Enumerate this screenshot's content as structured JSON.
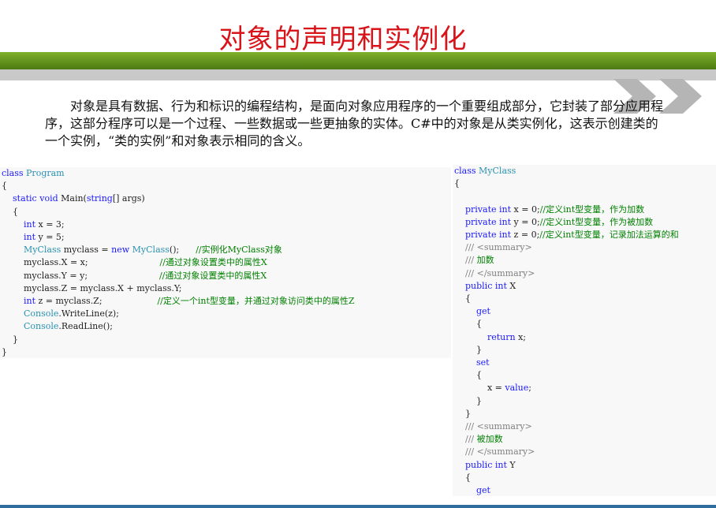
{
  "title": "对象的声明和实例化",
  "paragraph": "对象是具有数据、行为和标识的编程结构，是面向对象应用程序的一个重要组成部分，它封装了部分应用程序，这部分程序可以是一个过程、一些数据或一些更抽象的实体。C#中的对象是从类实例化，这表示创建类的一个实例，“类的实例”和对象表示相同的含义。",
  "colors": {
    "title": "#d8141a",
    "green_bar": "#6a9a1f",
    "gray_bar": "#c9c9c9",
    "keyword": "#1a1aff",
    "type": "#2b91af",
    "comment": "#008000"
  },
  "code_left": [
    [
      [
        "kw",
        "class"
      ],
      [
        "t",
        " "
      ],
      [
        "ty",
        "Program"
      ]
    ],
    [
      [
        "t",
        "{"
      ]
    ],
    [
      [
        "t",
        "    "
      ],
      [
        "kw",
        "static"
      ],
      [
        "t",
        " "
      ],
      [
        "kw",
        "void"
      ],
      [
        "t",
        " Main("
      ],
      [
        "kw",
        "string"
      ],
      [
        "t",
        "[] args)"
      ]
    ],
    [
      [
        "t",
        "    {"
      ]
    ],
    [
      [
        "t",
        "        "
      ],
      [
        "kw",
        "int"
      ],
      [
        "t",
        " x = 3;"
      ]
    ],
    [
      [
        "t",
        "        "
      ],
      [
        "kw",
        "int"
      ],
      [
        "t",
        " y = 5;"
      ]
    ],
    [
      [
        "t",
        "        "
      ],
      [
        "ty",
        "MyClass"
      ],
      [
        "t",
        " myclass = "
      ],
      [
        "kw",
        "new"
      ],
      [
        "t",
        " "
      ],
      [
        "ty",
        "MyClass"
      ],
      [
        "t",
        "();      "
      ],
      [
        "cm",
        "//实例化MyClass对象"
      ]
    ],
    [
      [
        "t",
        "        myclass.X = x;                          "
      ],
      [
        "cm",
        "//通过对象设置类中的属性X"
      ]
    ],
    [
      [
        "t",
        "        myclass.Y = y;                          "
      ],
      [
        "cm",
        "//通过对象设置类中的属性X"
      ]
    ],
    [
      [
        "t",
        "        myclass.Z = myclass.X + myclass.Y;"
      ]
    ],
    [
      [
        "t",
        "        "
      ],
      [
        "kw",
        "int"
      ],
      [
        "t",
        " z = myclass.Z;                    "
      ],
      [
        "cm",
        "//定义一个int型变量，并通过对象访问类中的属性Z"
      ]
    ],
    [
      [
        "t",
        "        "
      ],
      [
        "ty",
        "Console"
      ],
      [
        "t",
        ".WriteLine(z);"
      ]
    ],
    [
      [
        "t",
        "        "
      ],
      [
        "ty",
        "Console"
      ],
      [
        "t",
        ".ReadLine();"
      ]
    ],
    [
      [
        "t",
        "    }"
      ]
    ],
    [
      [
        "t",
        "}"
      ]
    ]
  ],
  "code_right": [
    [
      [
        "kw",
        "class"
      ],
      [
        "t",
        " "
      ],
      [
        "ty",
        "MyClass"
      ]
    ],
    [
      [
        "t",
        "{"
      ]
    ],
    [
      [
        "t",
        ""
      ]
    ],
    [
      [
        "t",
        "    "
      ],
      [
        "kw",
        "private"
      ],
      [
        "t",
        " "
      ],
      [
        "kw",
        "int"
      ],
      [
        "t",
        " x = 0;"
      ],
      [
        "cm",
        "//定义int型变量，作为加数"
      ]
    ],
    [
      [
        "t",
        "    "
      ],
      [
        "kw",
        "private"
      ],
      [
        "t",
        " "
      ],
      [
        "kw",
        "int"
      ],
      [
        "t",
        " y = 0;"
      ],
      [
        "cm",
        "//定义int型变量，作为被加数"
      ]
    ],
    [
      [
        "t",
        "    "
      ],
      [
        "kw",
        "private"
      ],
      [
        "t",
        " "
      ],
      [
        "kw",
        "int"
      ],
      [
        "t",
        " z = 0;"
      ],
      [
        "cm",
        "//定义int型变量，记录加法运算的和"
      ]
    ],
    [
      [
        "gr",
        "    /// <summary>"
      ]
    ],
    [
      [
        "gr",
        "    /// "
      ],
      [
        "cm",
        "加数"
      ]
    ],
    [
      [
        "gr",
        "    /// </summary>"
      ]
    ],
    [
      [
        "t",
        "    "
      ],
      [
        "kw",
        "public"
      ],
      [
        "t",
        " "
      ],
      [
        "kw",
        "int"
      ],
      [
        "t",
        " X"
      ]
    ],
    [
      [
        "t",
        "    {"
      ]
    ],
    [
      [
        "t",
        "        "
      ],
      [
        "kw",
        "get"
      ]
    ],
    [
      [
        "t",
        "        {"
      ]
    ],
    [
      [
        "t",
        "            "
      ],
      [
        "kw",
        "return"
      ],
      [
        "t",
        " x;"
      ]
    ],
    [
      [
        "t",
        "        }"
      ]
    ],
    [
      [
        "t",
        "        "
      ],
      [
        "kw",
        "set"
      ]
    ],
    [
      [
        "t",
        "        {"
      ]
    ],
    [
      [
        "t",
        "            x = "
      ],
      [
        "kw",
        "value"
      ],
      [
        "t",
        ";"
      ]
    ],
    [
      [
        "t",
        "        }"
      ]
    ],
    [
      [
        "t",
        "    }"
      ]
    ],
    [
      [
        "gr",
        "    /// <summary>"
      ]
    ],
    [
      [
        "gr",
        "    /// "
      ],
      [
        "cm",
        "被加数"
      ]
    ],
    [
      [
        "gr",
        "    /// </summary>"
      ]
    ],
    [
      [
        "t",
        "    "
      ],
      [
        "kw",
        "public"
      ],
      [
        "t",
        " "
      ],
      [
        "kw",
        "int"
      ],
      [
        "t",
        " Y"
      ]
    ],
    [
      [
        "t",
        "    {"
      ]
    ],
    [
      [
        "t",
        "        "
      ],
      [
        "kw",
        "get"
      ]
    ],
    [
      [
        "t",
        "        {"
      ]
    ]
  ]
}
